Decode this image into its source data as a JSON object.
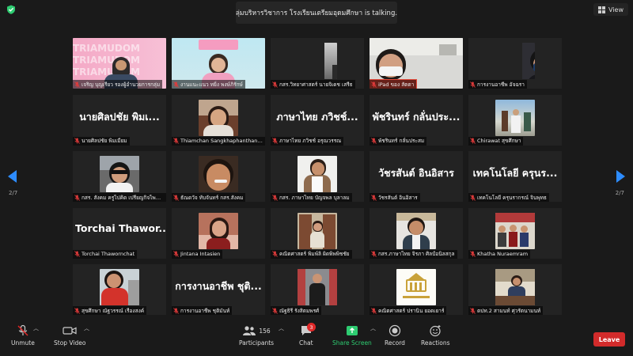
{
  "header": {
    "talking_banner": "กลุ่มบริหารวิชาการ โรงเรียนเตรียมอุดมศึกษา is talking...",
    "view_label": "View",
    "page_left": "2/7",
    "page_right": "2/7"
  },
  "participants": [
    {
      "label": "เจริญ บุญเรียว รองผู้อำนวยการกลุ่ม",
      "display_text": "",
      "video": "triamudom-banner"
    },
    {
      "label": "งานแนะแนว ทยิ่ง พงษ์ภิรักษ์",
      "display_text": "",
      "video": "person-pink"
    },
    {
      "label": "กสร.วิทยาศาสตร์ นายจิเดช เสรีธ",
      "display_text": "",
      "video": "dark-room"
    },
    {
      "label": "iPad ของ สัตตา",
      "display_text": "",
      "video": "person-mask-window"
    },
    {
      "label": "การงานอาชีพ อัจฉรา",
      "display_text": "",
      "video": "person-mask-dark"
    },
    {
      "label": "นายศิลปชัย พิมเมียม",
      "display_text": "นายศิลปชัย พิมเ...",
      "video": ""
    },
    {
      "label": "Thiamchan Sangkhaphanthanon",
      "display_text": "",
      "video": "person-smile"
    },
    {
      "label": "ภาษาไทย ภวิชช์ อรุณวรรณ",
      "display_text": "ภาษาไทย ภวิชช์...",
      "video": ""
    },
    {
      "label": "พัชรินทร์ กลั่นประสม",
      "display_text": "พัชรินทร์ กลั่นประ...",
      "video": ""
    },
    {
      "label": "Chirawat สุขศึกษา",
      "display_text": "",
      "video": "outdoor-people"
    },
    {
      "label": "กสร. สังคม ครูไปคิด เปรียญกิจไพศาล",
      "display_text": "",
      "video": "person-car"
    },
    {
      "label": "ธัณดวัจ ทับจันทร์ กสร.สังคม",
      "display_text": "",
      "video": "person-close"
    },
    {
      "label": "กสร. ภาษาไทย บัญจพล บุลาลม",
      "display_text": "",
      "video": "person-white-shirt"
    },
    {
      "label": "วัชรสันต์ อินอิสาร",
      "display_text": "วัชรสันต์ อินอิสาร",
      "video": ""
    },
    {
      "label": "เทคโนโลยี ครุนรากรณ์ จินพุทธ",
      "display_text": "เทคโนโลยี ครุนร...",
      "video": ""
    },
    {
      "label": "Torchai Thawornchat",
      "display_text": "Torchai Thawor...",
      "video": ""
    },
    {
      "label": "Jintana Intasien",
      "display_text": "",
      "video": "person-flowers"
    },
    {
      "label": "คณิตศาสตร์ พิมพ์ลิ ผิดพิพพิชชัย",
      "display_text": "",
      "video": "person-cabinet"
    },
    {
      "label": "กสร.ภาษาไทย จิรภา ศิลป์อนิลสกุล",
      "display_text": "",
      "video": "person-red-shirt"
    },
    {
      "label": "Khatha Nuraemram",
      "display_text": "",
      "video": "group-photo"
    },
    {
      "label": "สุขศึกษา ณัฐวรรณ์ เรืองสงค์",
      "display_text": "",
      "video": "person-red-chair"
    },
    {
      "label": "การงานอาชีพ ชุติมันท์",
      "display_text": "การงานอาชีพ ชุติ...",
      "video": ""
    },
    {
      "label": "ณัฐธิรี รังสิตมพรศ์",
      "display_text": "",
      "video": "person-standing"
    },
    {
      "label": "คณิตศาสตร์ ปรานิน ยอดเยาร์",
      "display_text": "",
      "video": "school-logo"
    },
    {
      "label": "ตปท.2 สามนท์ ศุวรัตนามนท์",
      "display_text": "",
      "video": "person-desk"
    }
  ],
  "toolbar": {
    "unmute_label": "Unmute",
    "stop_video_label": "Stop Video",
    "participants_label": "Participants",
    "participants_count": "156",
    "chat_label": "Chat",
    "chat_badge": "3",
    "share_label": "Share Screen",
    "record_label": "Record",
    "reactions_label": "Reactions",
    "leave_label": "Leave"
  },
  "colors": {
    "accent": "#2d8cff",
    "leave": "#d22b2b",
    "share": "#2ecc71",
    "background": "#1a1a1a",
    "tile": "#232323"
  }
}
